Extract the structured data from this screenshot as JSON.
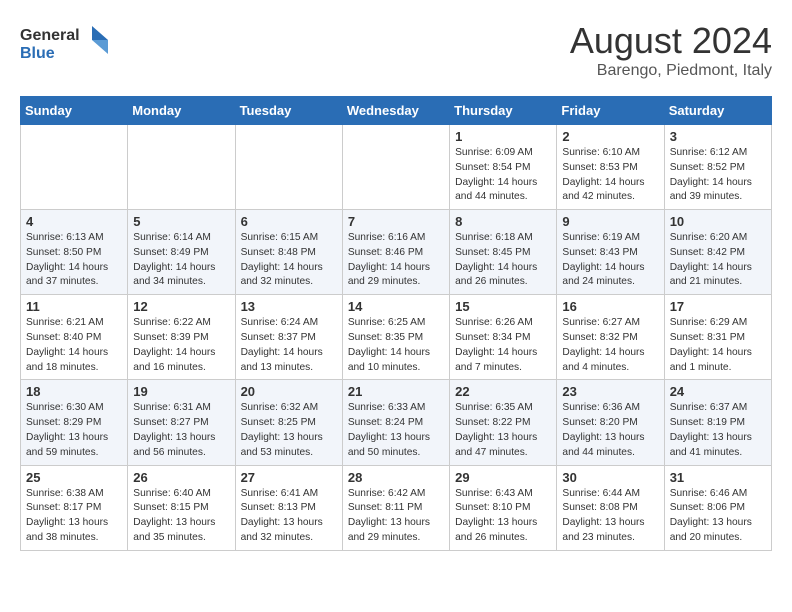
{
  "header": {
    "logo_line1": "General",
    "logo_line2": "Blue",
    "month_year": "August 2024",
    "location": "Barengo, Piedmont, Italy"
  },
  "days_of_week": [
    "Sunday",
    "Monday",
    "Tuesday",
    "Wednesday",
    "Thursday",
    "Friday",
    "Saturday"
  ],
  "weeks": [
    [
      {
        "day": "",
        "info": ""
      },
      {
        "day": "",
        "info": ""
      },
      {
        "day": "",
        "info": ""
      },
      {
        "day": "",
        "info": ""
      },
      {
        "day": "1",
        "info": "Sunrise: 6:09 AM\nSunset: 8:54 PM\nDaylight: 14 hours\nand 44 minutes."
      },
      {
        "day": "2",
        "info": "Sunrise: 6:10 AM\nSunset: 8:53 PM\nDaylight: 14 hours\nand 42 minutes."
      },
      {
        "day": "3",
        "info": "Sunrise: 6:12 AM\nSunset: 8:52 PM\nDaylight: 14 hours\nand 39 minutes."
      }
    ],
    [
      {
        "day": "4",
        "info": "Sunrise: 6:13 AM\nSunset: 8:50 PM\nDaylight: 14 hours\nand 37 minutes."
      },
      {
        "day": "5",
        "info": "Sunrise: 6:14 AM\nSunset: 8:49 PM\nDaylight: 14 hours\nand 34 minutes."
      },
      {
        "day": "6",
        "info": "Sunrise: 6:15 AM\nSunset: 8:48 PM\nDaylight: 14 hours\nand 32 minutes."
      },
      {
        "day": "7",
        "info": "Sunrise: 6:16 AM\nSunset: 8:46 PM\nDaylight: 14 hours\nand 29 minutes."
      },
      {
        "day": "8",
        "info": "Sunrise: 6:18 AM\nSunset: 8:45 PM\nDaylight: 14 hours\nand 26 minutes."
      },
      {
        "day": "9",
        "info": "Sunrise: 6:19 AM\nSunset: 8:43 PM\nDaylight: 14 hours\nand 24 minutes."
      },
      {
        "day": "10",
        "info": "Sunrise: 6:20 AM\nSunset: 8:42 PM\nDaylight: 14 hours\nand 21 minutes."
      }
    ],
    [
      {
        "day": "11",
        "info": "Sunrise: 6:21 AM\nSunset: 8:40 PM\nDaylight: 14 hours\nand 18 minutes."
      },
      {
        "day": "12",
        "info": "Sunrise: 6:22 AM\nSunset: 8:39 PM\nDaylight: 14 hours\nand 16 minutes."
      },
      {
        "day": "13",
        "info": "Sunrise: 6:24 AM\nSunset: 8:37 PM\nDaylight: 14 hours\nand 13 minutes."
      },
      {
        "day": "14",
        "info": "Sunrise: 6:25 AM\nSunset: 8:35 PM\nDaylight: 14 hours\nand 10 minutes."
      },
      {
        "day": "15",
        "info": "Sunrise: 6:26 AM\nSunset: 8:34 PM\nDaylight: 14 hours\nand 7 minutes."
      },
      {
        "day": "16",
        "info": "Sunrise: 6:27 AM\nSunset: 8:32 PM\nDaylight: 14 hours\nand 4 minutes."
      },
      {
        "day": "17",
        "info": "Sunrise: 6:29 AM\nSunset: 8:31 PM\nDaylight: 14 hours\nand 1 minute."
      }
    ],
    [
      {
        "day": "18",
        "info": "Sunrise: 6:30 AM\nSunset: 8:29 PM\nDaylight: 13 hours\nand 59 minutes."
      },
      {
        "day": "19",
        "info": "Sunrise: 6:31 AM\nSunset: 8:27 PM\nDaylight: 13 hours\nand 56 minutes."
      },
      {
        "day": "20",
        "info": "Sunrise: 6:32 AM\nSunset: 8:25 PM\nDaylight: 13 hours\nand 53 minutes."
      },
      {
        "day": "21",
        "info": "Sunrise: 6:33 AM\nSunset: 8:24 PM\nDaylight: 13 hours\nand 50 minutes."
      },
      {
        "day": "22",
        "info": "Sunrise: 6:35 AM\nSunset: 8:22 PM\nDaylight: 13 hours\nand 47 minutes."
      },
      {
        "day": "23",
        "info": "Sunrise: 6:36 AM\nSunset: 8:20 PM\nDaylight: 13 hours\nand 44 minutes."
      },
      {
        "day": "24",
        "info": "Sunrise: 6:37 AM\nSunset: 8:19 PM\nDaylight: 13 hours\nand 41 minutes."
      }
    ],
    [
      {
        "day": "25",
        "info": "Sunrise: 6:38 AM\nSunset: 8:17 PM\nDaylight: 13 hours\nand 38 minutes."
      },
      {
        "day": "26",
        "info": "Sunrise: 6:40 AM\nSunset: 8:15 PM\nDaylight: 13 hours\nand 35 minutes."
      },
      {
        "day": "27",
        "info": "Sunrise: 6:41 AM\nSunset: 8:13 PM\nDaylight: 13 hours\nand 32 minutes."
      },
      {
        "day": "28",
        "info": "Sunrise: 6:42 AM\nSunset: 8:11 PM\nDaylight: 13 hours\nand 29 minutes."
      },
      {
        "day": "29",
        "info": "Sunrise: 6:43 AM\nSunset: 8:10 PM\nDaylight: 13 hours\nand 26 minutes."
      },
      {
        "day": "30",
        "info": "Sunrise: 6:44 AM\nSunset: 8:08 PM\nDaylight: 13 hours\nand 23 minutes."
      },
      {
        "day": "31",
        "info": "Sunrise: 6:46 AM\nSunset: 8:06 PM\nDaylight: 13 hours\nand 20 minutes."
      }
    ]
  ]
}
